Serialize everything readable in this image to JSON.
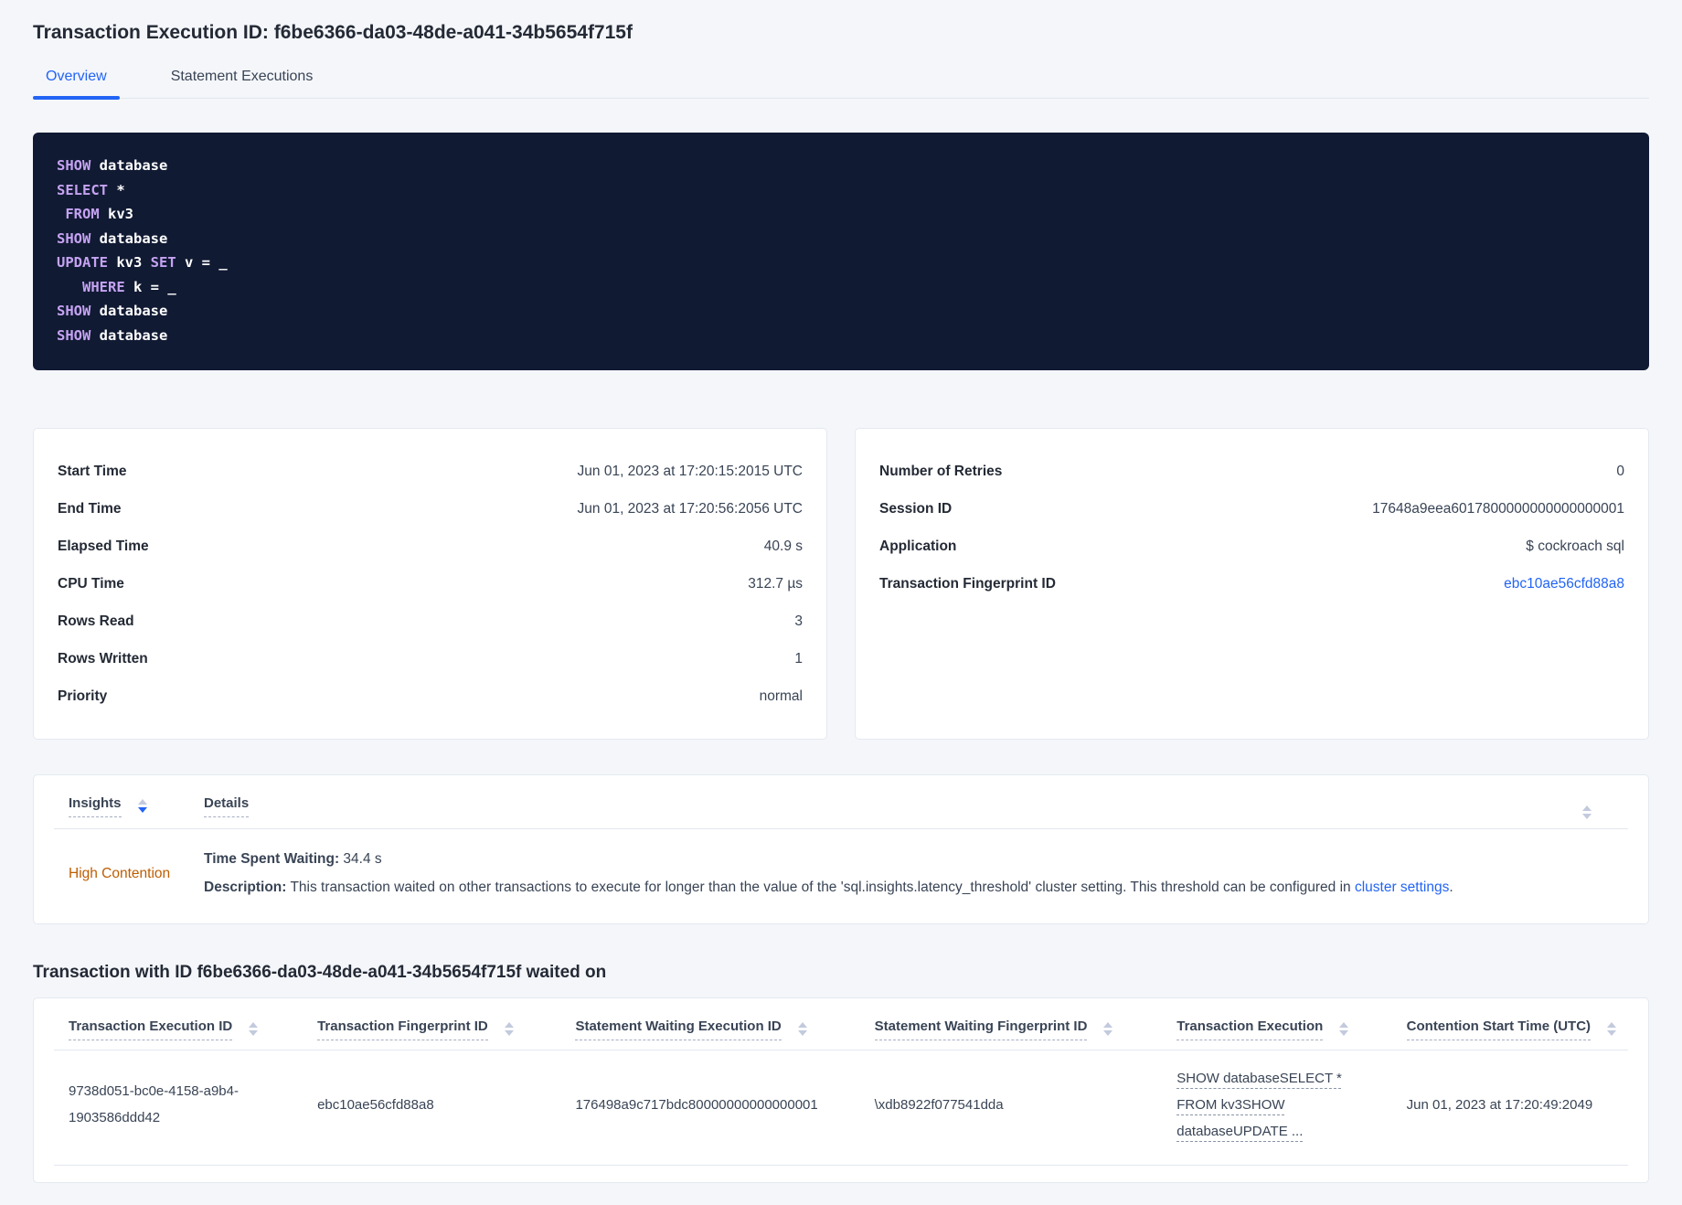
{
  "colors": {
    "accent_blue": "#2264f5",
    "warning_orange": "#be5d00",
    "code_background": "#111a33",
    "code_keyword_purple": "#c5a3f2",
    "page_background": "#f4f6fa"
  },
  "header": {
    "title": "Transaction Execution ID: f6be6366-da03-48de-a041-34b5654f715f",
    "tabs": [
      {
        "label": "Overview",
        "active": true
      },
      {
        "label": "Statement Executions",
        "active": false
      }
    ]
  },
  "sql_statements": {
    "lines": [
      [
        {
          "k": "SHOW"
        },
        {
          "t": " database"
        }
      ],
      [
        {
          "k": "SELECT"
        },
        {
          "t": " *"
        }
      ],
      [
        {
          "t": " "
        },
        {
          "k": "FROM"
        },
        {
          "t": " kv3"
        }
      ],
      [
        {
          "k": "SHOW"
        },
        {
          "t": " database"
        }
      ],
      [
        {
          "k": "UPDATE"
        },
        {
          "t": " kv3 "
        },
        {
          "k": "SET"
        },
        {
          "t": " v = _"
        }
      ],
      [
        {
          "t": "   "
        },
        {
          "k": "WHERE"
        },
        {
          "t": " k = _"
        }
      ],
      [
        {
          "k": "SHOW"
        },
        {
          "t": " database"
        }
      ],
      [
        {
          "k": "SHOW"
        },
        {
          "t": " database"
        }
      ]
    ]
  },
  "summary_left": {
    "rows": [
      {
        "label": "Start Time",
        "value": "Jun 01, 2023 at 17:20:15:2015 UTC"
      },
      {
        "label": "End Time",
        "value": "Jun 01, 2023 at 17:20:56:2056 UTC"
      },
      {
        "label": "Elapsed Time",
        "value": "40.9 s"
      },
      {
        "label": "CPU Time",
        "value": "312.7 µs"
      },
      {
        "label": "Rows Read",
        "value": "3"
      },
      {
        "label": "Rows Written",
        "value": "1"
      },
      {
        "label": "Priority",
        "value": "normal"
      }
    ]
  },
  "summary_right": {
    "rows": [
      {
        "label": "Number of Retries",
        "value": "0"
      },
      {
        "label": "Session ID",
        "value": "17648a9eea6017800000000000000001"
      },
      {
        "label": "Application",
        "value": "$ cockroach sql"
      },
      {
        "label": "Transaction Fingerprint ID",
        "value": "ebc10ae56cfd88a8",
        "link": true
      }
    ]
  },
  "insights_table": {
    "columns": [
      {
        "label": "Insights"
      },
      {
        "label": "Details"
      }
    ],
    "row": {
      "insight": "High Contention",
      "waiting_label": "Time Spent Waiting:",
      "waiting_value": " 34.4 s",
      "description_label": "Description:",
      "description_text": " This transaction waited on other transactions to execute for longer than the value of the 'sql.insights.latency_threshold' cluster setting. This threshold can be configured in ",
      "description_link": "cluster settings",
      "description_suffix": "."
    }
  },
  "waited_on": {
    "heading": "Transaction with ID f6be6366-da03-48de-a041-34b5654f715f waited on",
    "columns": [
      "Transaction Execution ID",
      "Transaction Fingerprint ID",
      "Statement Waiting Execution ID",
      "Statement Waiting Fingerprint ID",
      "Transaction Execution",
      "Contention Start Time (UTC)"
    ],
    "row": {
      "transaction_execution_id": "9738d051-bc0e-4158-a9b4-1903586ddd42",
      "transaction_fingerprint_id": "ebc10ae56cfd88a8",
      "statement_waiting_execution_id": "176498a9c717bdc80000000000000001",
      "statement_waiting_fingerprint_id": "\\xdb8922f077541dda",
      "transaction_execution": "SHOW databaseSELECT * FROM kv3SHOW databaseUPDATE ...",
      "contention_start_time": "Jun 01, 2023 at 17:20:49:2049"
    }
  }
}
